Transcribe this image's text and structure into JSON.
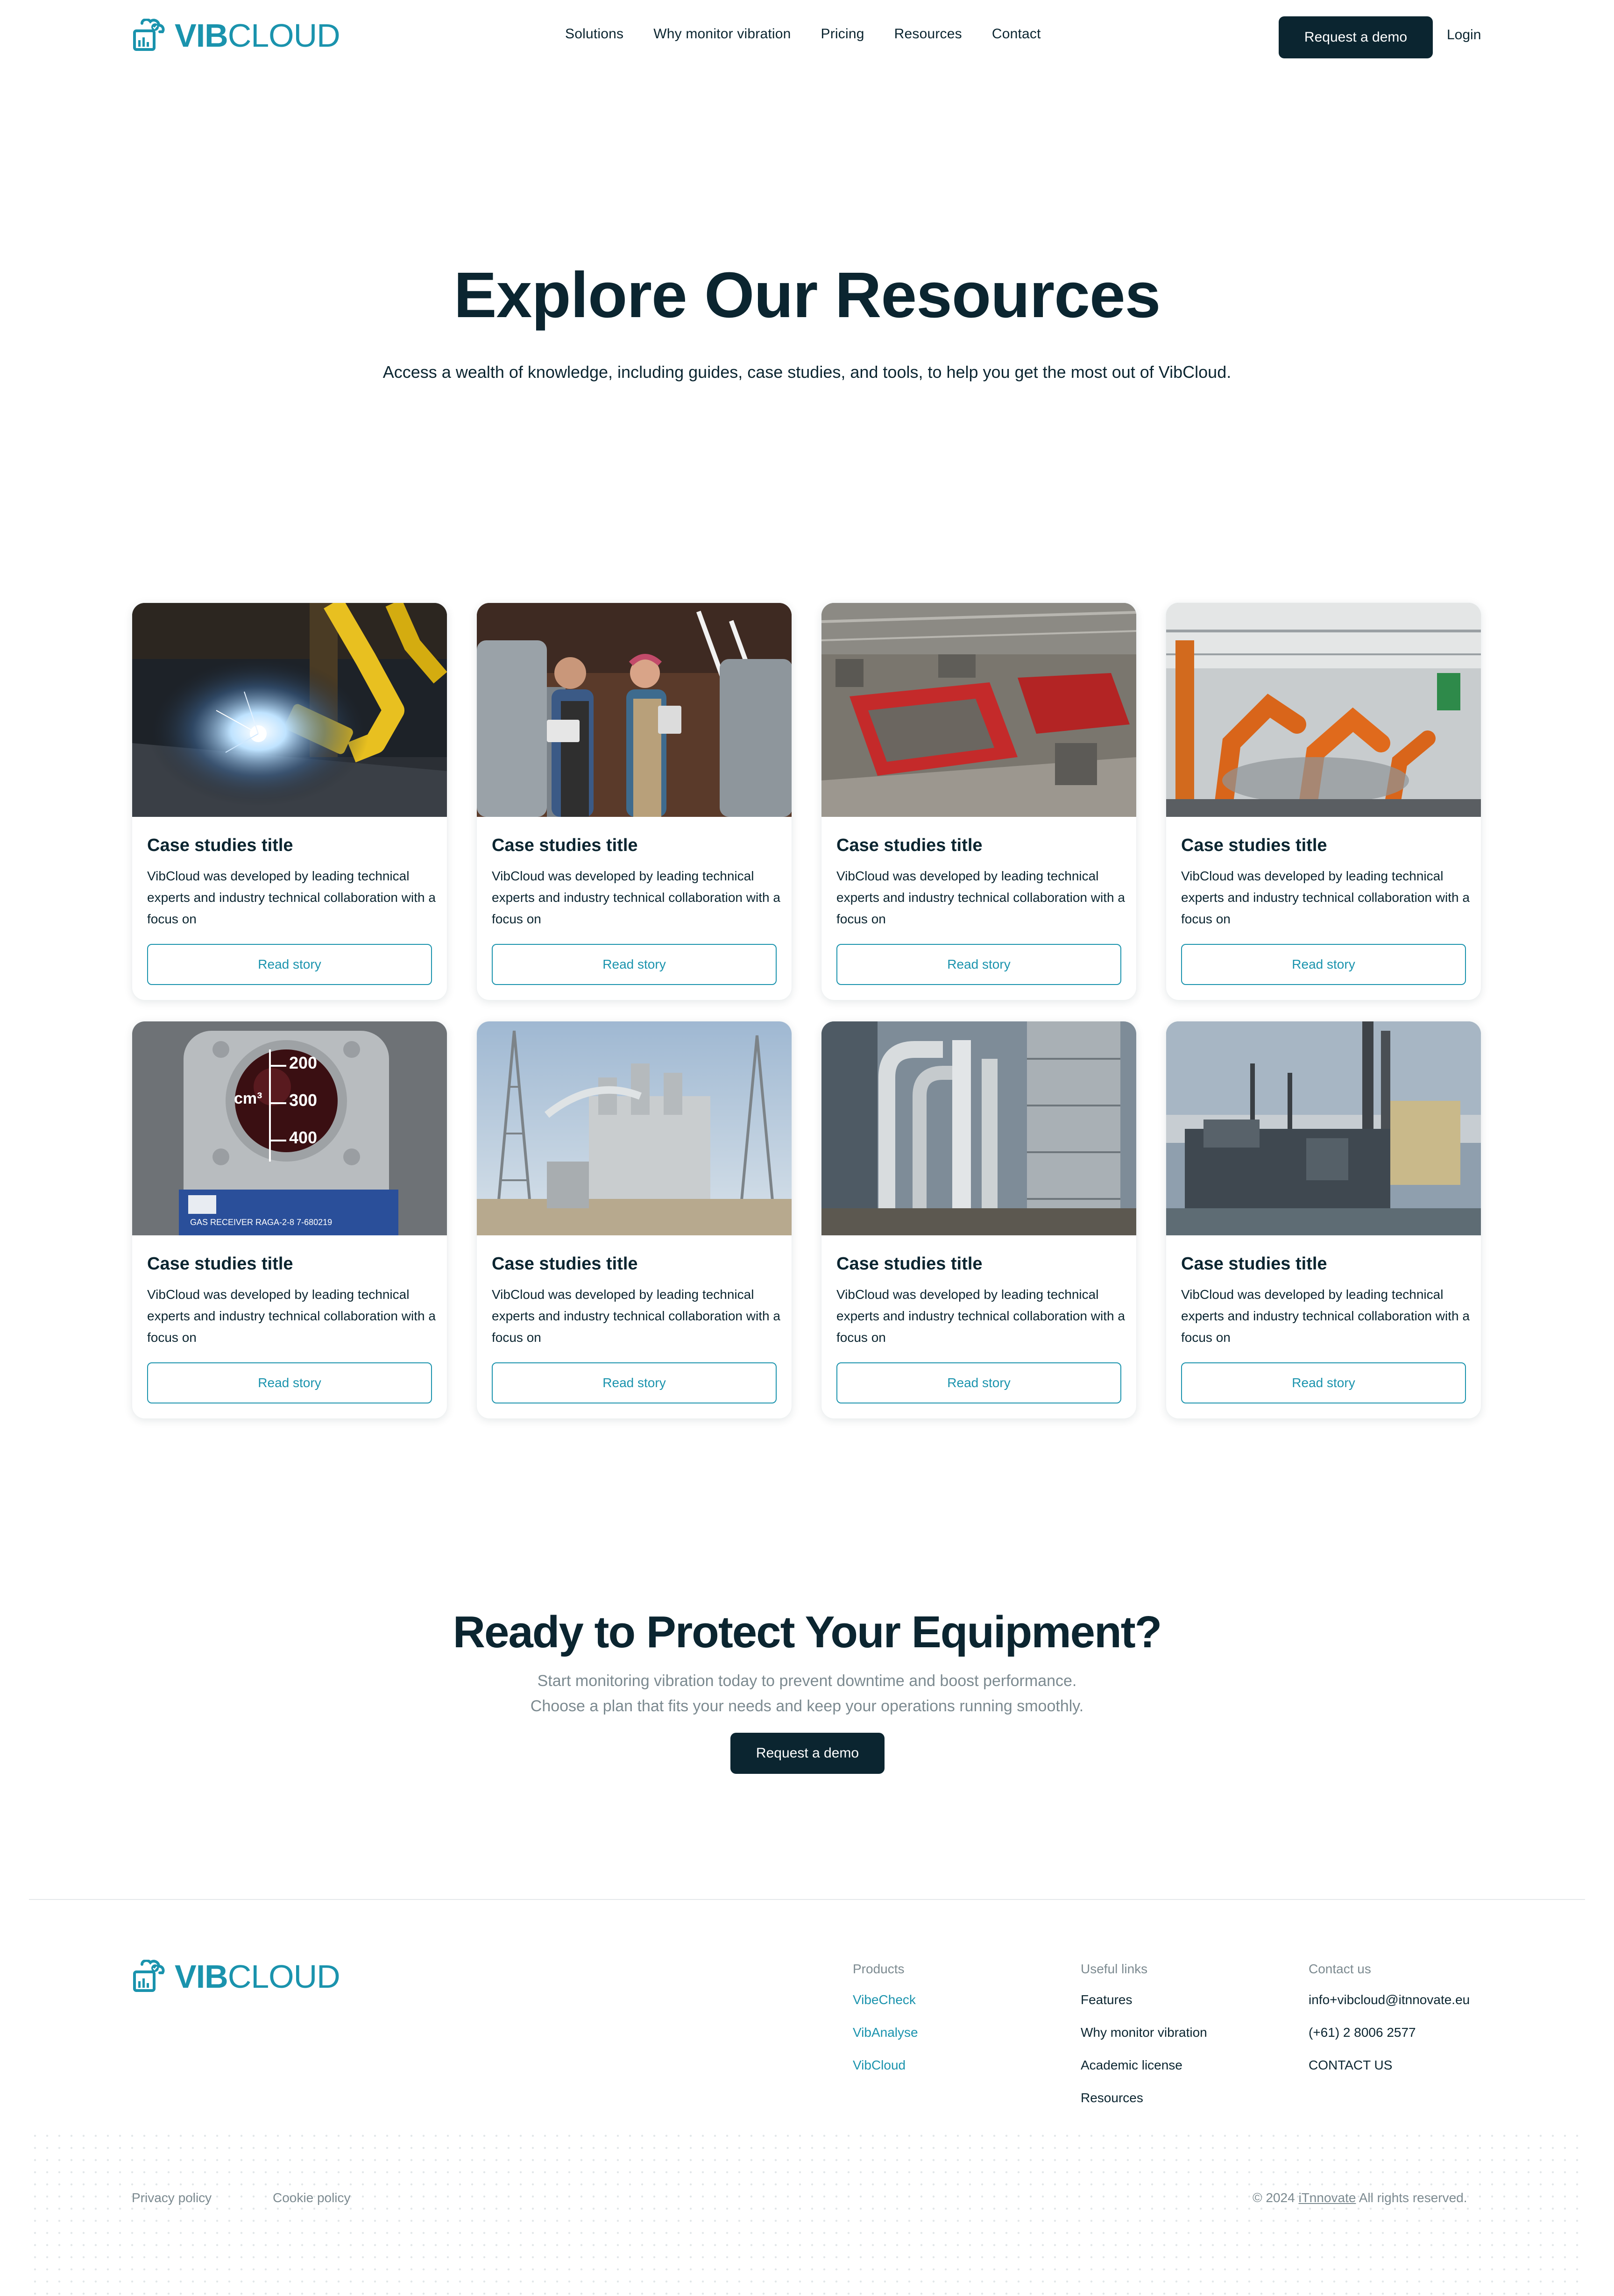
{
  "brand": {
    "name_bold": "VIB",
    "name_light": "CLOUD",
    "color": "#1a93ad",
    "dark": "#0b2530"
  },
  "nav": {
    "items": [
      "Solutions",
      "Why monitor vibration",
      "Pricing",
      "Resources",
      "Contact"
    ],
    "cta": "Request a demo",
    "login": "Login"
  },
  "hero": {
    "title": "Explore Our Resources",
    "subtitle": "Access a wealth of knowledge, including guides, case studies, and tools, to help you get the most out of VibCloud."
  },
  "cards": [
    {
      "image": "welding-robot",
      "title": "Case studies title",
      "description": "VibCloud was developed by leading technical experts and industry technical collaboration with a focus on",
      "button": "Read story"
    },
    {
      "image": "brewery-workers",
      "title": "Case studies title",
      "description": "VibCloud was developed by leading technical experts and industry technical collaboration with a focus on",
      "button": "Read story"
    },
    {
      "image": "factory-floor",
      "title": "Case studies title",
      "description": "VibCloud was developed by leading technical experts and industry technical collaboration with a focus on",
      "button": "Read story"
    },
    {
      "image": "robotic-assembly-line",
      "title": "Case studies title",
      "description": "VibCloud was developed by leading technical experts and industry technical collaboration with a focus on",
      "button": "Read story"
    },
    {
      "image": "gas-meter-gauge",
      "title": "Case studies title",
      "description": "VibCloud was developed by leading technical experts and industry technical collaboration with a focus on",
      "button": "Read story"
    },
    {
      "image": "power-substation",
      "title": "Case studies title",
      "description": "VibCloud was developed by leading technical experts and industry technical collaboration with a focus on",
      "button": "Read story"
    },
    {
      "image": "industrial-pipes",
      "title": "Case studies title",
      "description": "VibCloud was developed by leading technical experts and industry technical collaboration with a focus on",
      "button": "Read story"
    },
    {
      "image": "power-plant",
      "title": "Case studies title",
      "description": "VibCloud was developed by leading technical experts and industry technical collaboration with a focus on",
      "button": "Read story"
    }
  ],
  "gauge": {
    "ticks": [
      "200",
      "300",
      "400"
    ],
    "unit": "cm³",
    "plate": "GAS RECEIVER  RAGA-2-8  7-680219"
  },
  "cta": {
    "title": "Ready to Protect Your Equipment?",
    "line1": "Start monitoring vibration today to prevent downtime and boost performance.",
    "line2": "Choose a plan that fits your needs and keep your operations running smoothly.",
    "button": "Request a demo"
  },
  "footer": {
    "products": {
      "heading": "Products",
      "links": [
        "VibeCheck",
        "VibAnalyse",
        "VibCloud"
      ]
    },
    "useful": {
      "heading": "Useful links",
      "links": [
        "Features",
        "Why monitor vibration",
        "Academic license",
        "Resources"
      ]
    },
    "contact": {
      "heading": "Contact us",
      "email": "info+vibcloud@itnnovate.eu",
      "phone": "(+61) 2 8006 2577",
      "link": "CONTACT US"
    },
    "privacy": "Privacy policy",
    "cookie": "Cookie policy",
    "copyright_pre": "© 2024",
    "copyright_company": "iTnnovate",
    "copyright_post": "All rights reserved."
  }
}
